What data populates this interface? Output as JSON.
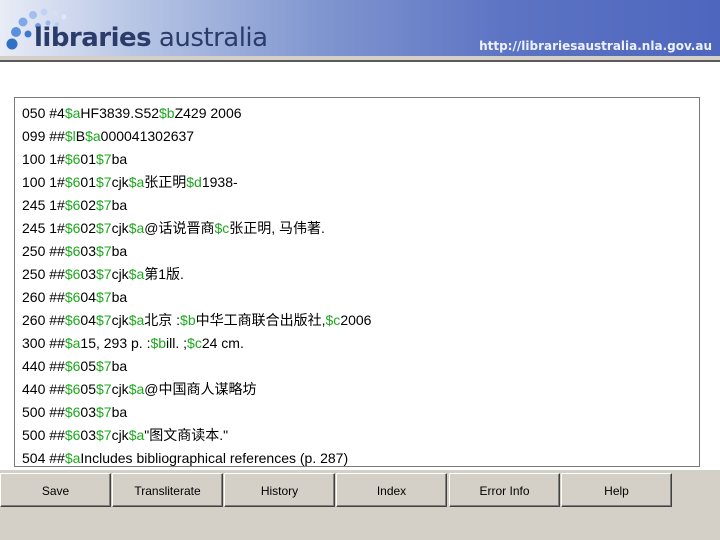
{
  "banner": {
    "logo_word1": "libraries",
    "logo_word2": " australia",
    "url": "http://librariesaustralia.nla.gov.au"
  },
  "colors": {
    "subfield": "#1ea81e",
    "logo_text": "#2b3b6a"
  },
  "record_lines": [
    [
      {
        "t": "050 #4"
      },
      {
        "t": "$a",
        "sf": true
      },
      {
        "t": "HF3839.S52"
      },
      {
        "t": "$b",
        "sf": true
      },
      {
        "t": "Z429 2006"
      }
    ],
    [
      {
        "t": "099 ##"
      },
      {
        "t": "$l",
        "sf": true
      },
      {
        "t": "B"
      },
      {
        "t": "$a",
        "sf": true
      },
      {
        "t": "000041302637"
      }
    ],
    [
      {
        "t": "100 1#"
      },
      {
        "t": "$6",
        "sf": true
      },
      {
        "t": "01"
      },
      {
        "t": "$7",
        "sf": true
      },
      {
        "t": "ba"
      }
    ],
    [
      {
        "t": "100 1#"
      },
      {
        "t": "$6",
        "sf": true
      },
      {
        "t": "01"
      },
      {
        "t": "$7",
        "sf": true
      },
      {
        "t": "cjk"
      },
      {
        "t": "$a",
        "sf": true
      },
      {
        "t": "张正明"
      },
      {
        "t": "$d",
        "sf": true
      },
      {
        "t": "1938-"
      }
    ],
    [
      {
        "t": "245 1#"
      },
      {
        "t": "$6",
        "sf": true
      },
      {
        "t": "02"
      },
      {
        "t": "$7",
        "sf": true
      },
      {
        "t": "ba"
      }
    ],
    [
      {
        "t": "245 1#"
      },
      {
        "t": "$6",
        "sf": true
      },
      {
        "t": "02"
      },
      {
        "t": "$7",
        "sf": true
      },
      {
        "t": "cjk"
      },
      {
        "t": "$a",
        "sf": true
      },
      {
        "t": "@话说晋商"
      },
      {
        "t": "$c",
        "sf": true
      },
      {
        "t": "张正明, 马伟著."
      }
    ],
    [
      {
        "t": "250 ##"
      },
      {
        "t": "$6",
        "sf": true
      },
      {
        "t": "03"
      },
      {
        "t": "$7",
        "sf": true
      },
      {
        "t": "ba"
      }
    ],
    [
      {
        "t": "250 ##"
      },
      {
        "t": "$6",
        "sf": true
      },
      {
        "t": "03"
      },
      {
        "t": "$7",
        "sf": true
      },
      {
        "t": "cjk"
      },
      {
        "t": "$a",
        "sf": true
      },
      {
        "t": "第1版."
      }
    ],
    [
      {
        "t": "260 ##"
      },
      {
        "t": "$6",
        "sf": true
      },
      {
        "t": "04"
      },
      {
        "t": "$7",
        "sf": true
      },
      {
        "t": "ba"
      }
    ],
    [
      {
        "t": "260 ##"
      },
      {
        "t": "$6",
        "sf": true
      },
      {
        "t": "04"
      },
      {
        "t": "$7",
        "sf": true
      },
      {
        "t": "cjk"
      },
      {
        "t": "$a",
        "sf": true
      },
      {
        "t": "北京 :"
      },
      {
        "t": "$b",
        "sf": true
      },
      {
        "t": "中华工商联合出版社,"
      },
      {
        "t": "$c",
        "sf": true
      },
      {
        "t": "2006"
      }
    ],
    [
      {
        "t": "300 ##"
      },
      {
        "t": "$a",
        "sf": true
      },
      {
        "t": "15, 293 p. :"
      },
      {
        "t": "$b",
        "sf": true
      },
      {
        "t": "ill. ;"
      },
      {
        "t": "$c",
        "sf": true
      },
      {
        "t": "24 cm."
      }
    ],
    [
      {
        "t": "440 ##"
      },
      {
        "t": "$6",
        "sf": true
      },
      {
        "t": "05"
      },
      {
        "t": "$7",
        "sf": true
      },
      {
        "t": "ba"
      }
    ],
    [
      {
        "t": "440 ##"
      },
      {
        "t": "$6",
        "sf": true
      },
      {
        "t": "05"
      },
      {
        "t": "$7",
        "sf": true
      },
      {
        "t": "cjk"
      },
      {
        "t": "$a",
        "sf": true
      },
      {
        "t": "@中国商人谋略坊"
      }
    ],
    [
      {
        "t": "500 ##"
      },
      {
        "t": "$6",
        "sf": true
      },
      {
        "t": "03"
      },
      {
        "t": "$7",
        "sf": true
      },
      {
        "t": "ba"
      }
    ],
    [
      {
        "t": "500 ##"
      },
      {
        "t": "$6",
        "sf": true
      },
      {
        "t": "03"
      },
      {
        "t": "$7",
        "sf": true
      },
      {
        "t": "cjk"
      },
      {
        "t": "$a",
        "sf": true
      },
      {
        "t": "\"图文商读本.\""
      }
    ],
    [
      {
        "t": "504 ##"
      },
      {
        "t": "$a",
        "sf": true
      },
      {
        "t": "Includes bibliographical references (p. 287)"
      }
    ]
  ],
  "buttons": {
    "save": "Save",
    "transliterate": "Transliterate",
    "history": "History",
    "index": "Index",
    "error_info": "Error Info",
    "help": "Help"
  }
}
